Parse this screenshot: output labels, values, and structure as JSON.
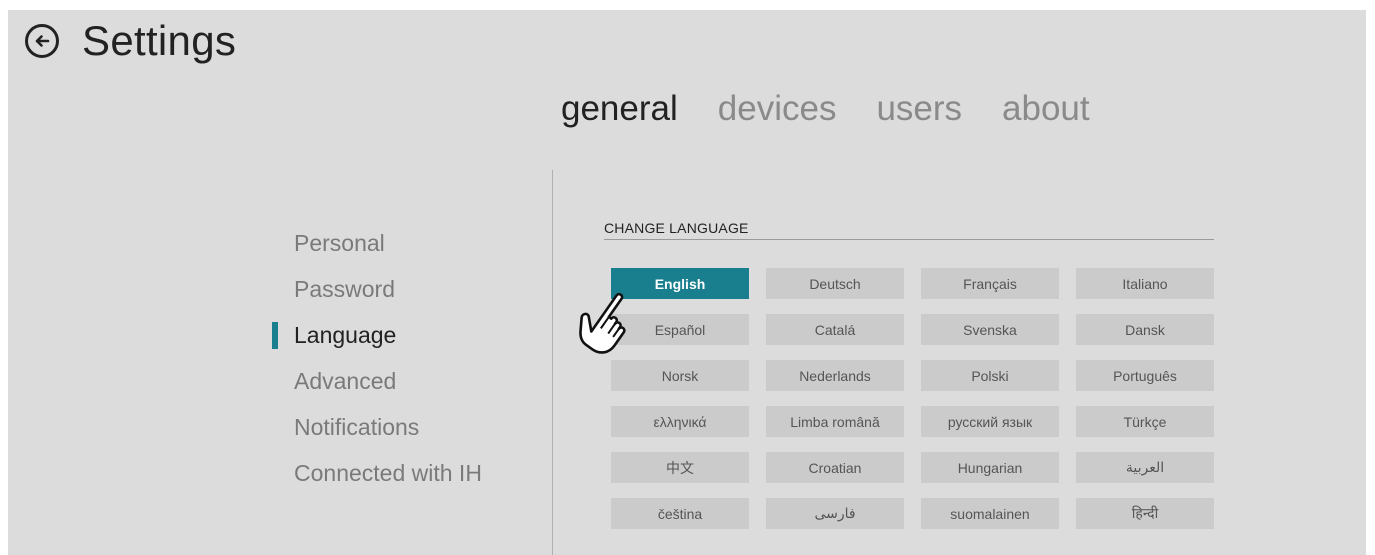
{
  "header": {
    "title": "Settings",
    "back_icon": "back-arrow-circle-icon"
  },
  "tabs": [
    {
      "label": "general",
      "active": true
    },
    {
      "label": "devices",
      "active": false
    },
    {
      "label": "users",
      "active": false
    },
    {
      "label": "about",
      "active": false
    }
  ],
  "sidebar": {
    "items": [
      {
        "label": "Personal",
        "active": false
      },
      {
        "label": "Password",
        "active": false
      },
      {
        "label": "Language",
        "active": true
      },
      {
        "label": "Advanced",
        "active": false
      },
      {
        "label": "Notifications",
        "active": false
      },
      {
        "label": "Connected with IH",
        "active": false
      }
    ]
  },
  "language": {
    "section_title": "CHANGE LANGUAGE",
    "selected": "English",
    "options": [
      "English",
      "Deutsch",
      "Français",
      "Italiano",
      "Español",
      "Catalá",
      "Svenska",
      "Dansk",
      "Norsk",
      "Nederlands",
      "Polski",
      "Português",
      "ελληνικά",
      "Limba română",
      "русский язык",
      "Türkçe",
      "中文",
      "Croatian",
      "Hungarian",
      "العربية",
      "čeština",
      "فارسی",
      "suomalainen",
      "हिन्दी"
    ]
  },
  "colors": {
    "accent": "#197e8e",
    "background": "#dcdcdc",
    "button": "#cbcbcb",
    "text_active": "#222222",
    "text_inactive": "#8a8a8a"
  },
  "cursor": {
    "icon": "hand-pointer-icon"
  }
}
